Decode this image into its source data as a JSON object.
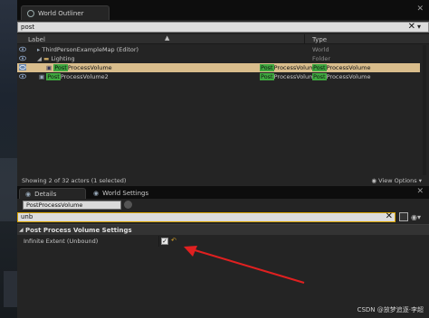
{
  "outliner": {
    "tab_title": "World Outliner",
    "search_value": "post",
    "columns": {
      "label": "Label",
      "type": "Type"
    },
    "rows": [
      {
        "name_pre": "",
        "name_hl": "",
        "name_post": "ThirdPersonExampleMap (Editor)",
        "type": "World"
      },
      {
        "name_pre": "",
        "name_hl": "",
        "name_post": "Lighting",
        "type": "Folder"
      },
      {
        "name_hl": "Post",
        "name_post": "ProcessVolume",
        "type_hl": "Post",
        "type_post": "ProcessVolume",
        "type2_hl": "Post",
        "type2_post": "ProcessVolume"
      },
      {
        "name_hl": "Post",
        "name_post": "ProcessVolume2",
        "type_hl": "Post",
        "type_post": "ProcessVolume",
        "type2_hl": "Post",
        "type2_post": "ProcessVolume"
      }
    ],
    "status_left": "Showing 2 of 32 actors (1 selected)",
    "status_right": "View Options ▾"
  },
  "details": {
    "tab_details": "Details",
    "tab_world_settings": "World Settings",
    "object_name": "PostProcessVolume",
    "search_value": "unb",
    "category": "Post Process Volume Settings",
    "property_label": "Infinite Extent (Unbound)",
    "property_checked": "✓",
    "reset_glyph": "↶"
  },
  "watermark": "CSDN @放梦追逐·李超",
  "colors": {
    "selected_row": "#d9bd8c",
    "highlight": "#3fa83f",
    "arrow": "#e02020",
    "search_focus": "#d9a400"
  }
}
